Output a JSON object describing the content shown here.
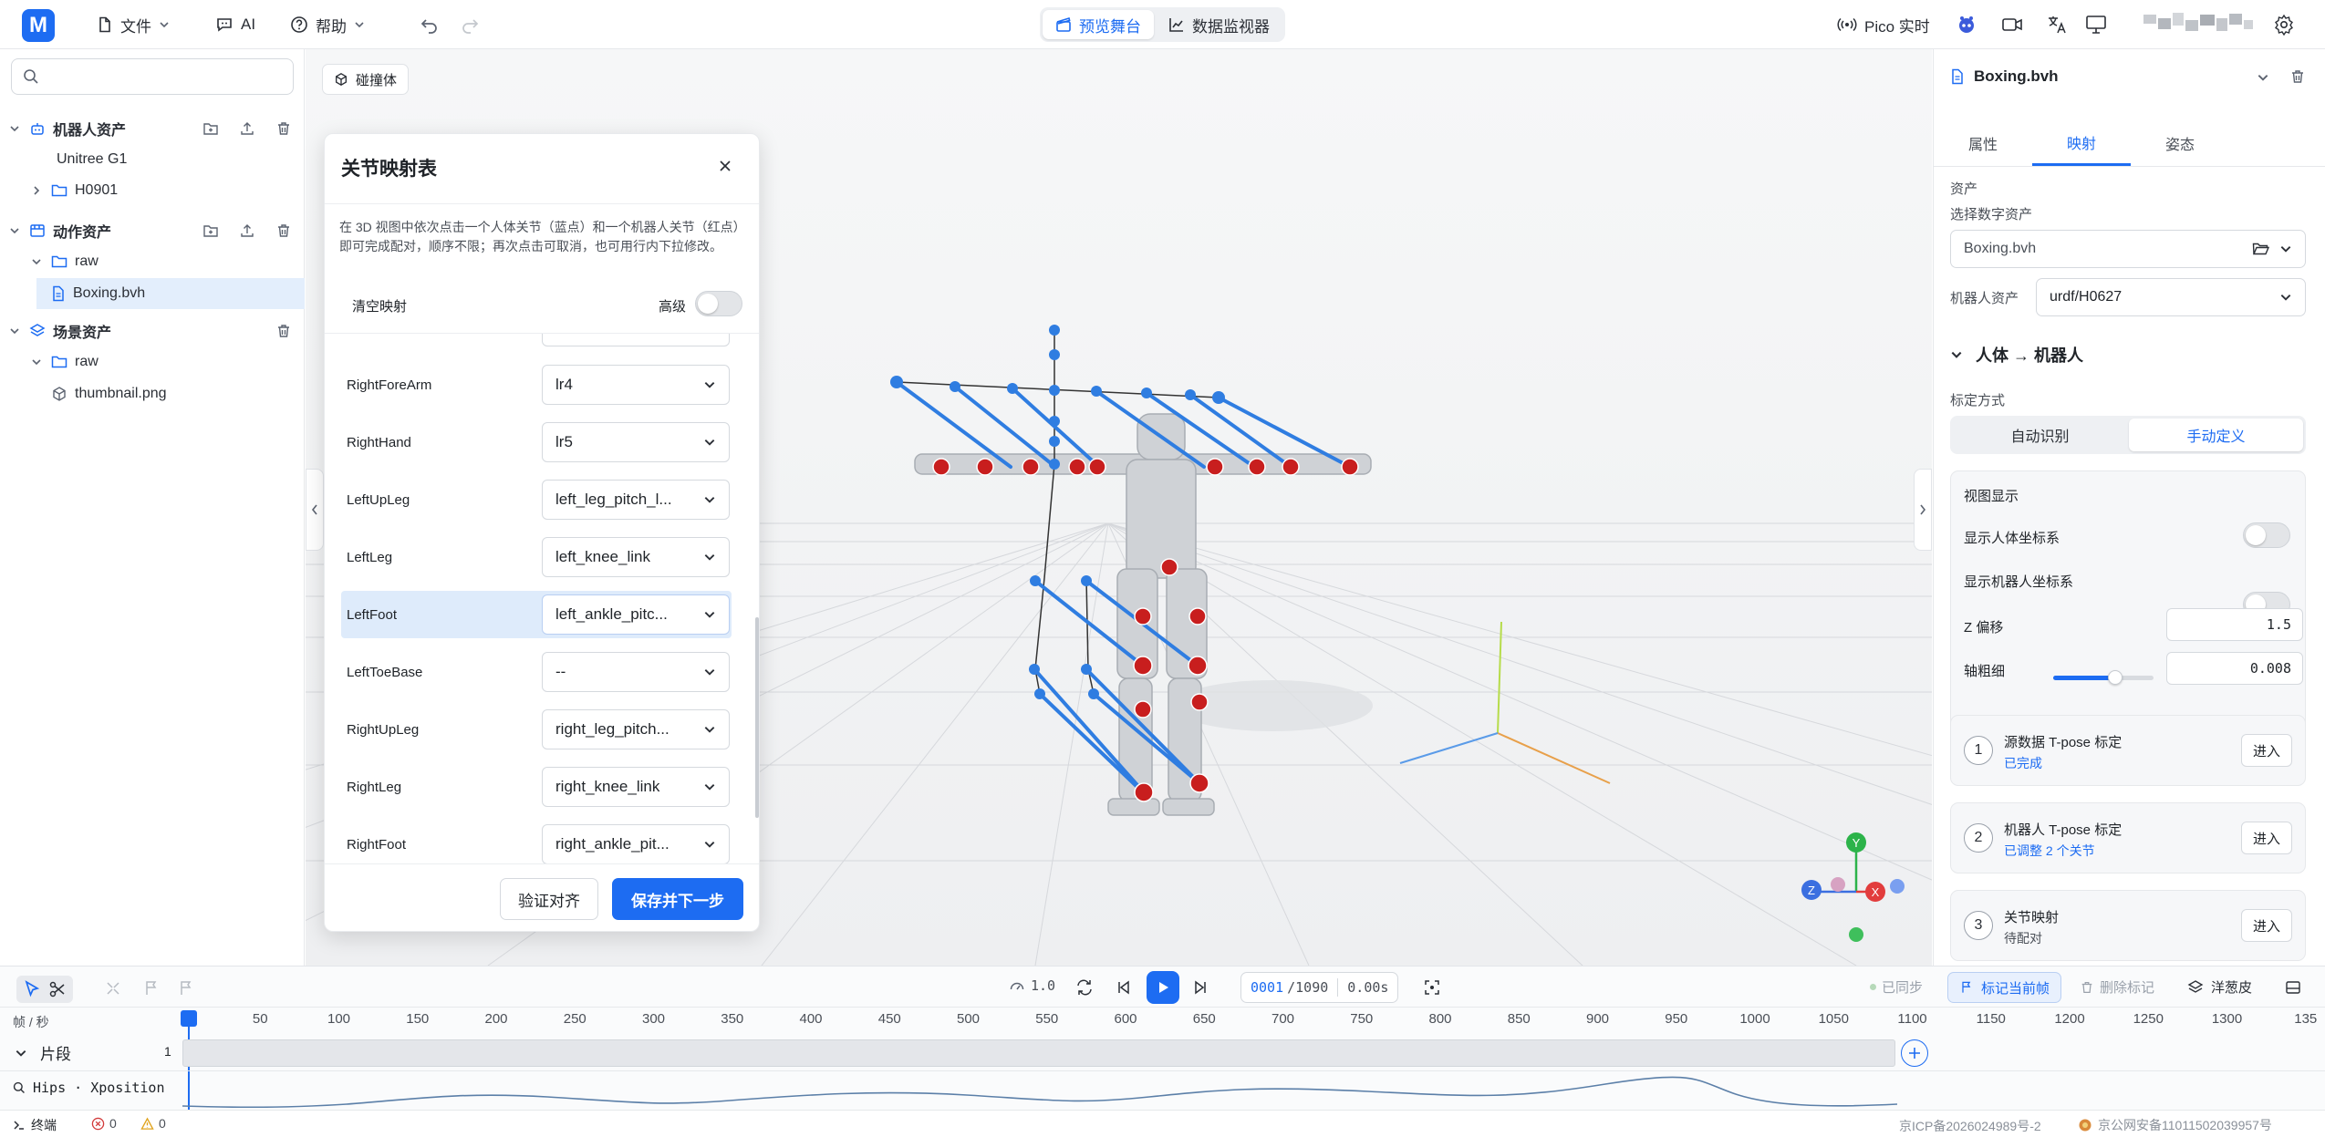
{
  "topbar": {
    "logo": "M",
    "menu": [
      {
        "label": "文件",
        "icon": "file-icon"
      },
      {
        "label": "AI",
        "icon": "ai-chat-icon"
      },
      {
        "label": "帮助",
        "icon": "help-icon"
      }
    ],
    "views": [
      {
        "label": "预览舞台",
        "icon": "clapperboard-icon",
        "active": true
      },
      {
        "label": "数据监视器",
        "icon": "line-chart-icon",
        "active": false
      }
    ],
    "pico_label": "Pico 实时"
  },
  "sidebar": {
    "search_placeholder": "",
    "tree": [
      {
        "label": "机器人资产",
        "level": 0,
        "type": "group",
        "expanded": true,
        "actions": true
      },
      {
        "label": "Unitree G1",
        "level": 1,
        "type": "item"
      },
      {
        "label": "H0901",
        "level": 1,
        "type": "folder",
        "expanded": false
      },
      {
        "label": "动作资产",
        "level": 0,
        "type": "group",
        "expanded": true,
        "actions": true
      },
      {
        "label": "raw",
        "level": 1,
        "type": "folder",
        "expanded": true
      },
      {
        "label": "Boxing.bvh",
        "level": 2,
        "type": "file",
        "selected": true
      },
      {
        "label": "场景资产",
        "level": 0,
        "type": "group",
        "expanded": true,
        "actions": "delete-only"
      },
      {
        "label": "raw",
        "level": 1,
        "type": "folder",
        "expanded": true
      },
      {
        "label": "thumbnail.png",
        "level": 2,
        "type": "image"
      }
    ]
  },
  "viewport": {
    "collider_chip": "碰撞体"
  },
  "dialog": {
    "title": "关节映射表",
    "description": "在 3D 视图中依次点击一个人体关节（蓝点）和一个机器人关节（红点）即可完成配对，顺序不限；再次点击可取消，也可用行内下拉修改。",
    "clear_label": "清空映射",
    "advanced_label": "高级",
    "rows": [
      {
        "joint": "RightForeArm",
        "value": "lr4"
      },
      {
        "joint": "RightHand",
        "value": "lr5"
      },
      {
        "joint": "LeftUpLeg",
        "value": "left_leg_pitch_l..."
      },
      {
        "joint": "LeftLeg",
        "value": "left_knee_link"
      },
      {
        "joint": "LeftFoot",
        "value": "left_ankle_pitc...",
        "highlight": true
      },
      {
        "joint": "LeftToeBase",
        "value": "--"
      },
      {
        "joint": "RightUpLeg",
        "value": "right_leg_pitch..."
      },
      {
        "joint": "RightLeg",
        "value": "right_knee_link"
      },
      {
        "joint": "RightFoot",
        "value": "right_ankle_pit..."
      }
    ],
    "verify_button": "验证对齐",
    "save_button": "保存并下一步"
  },
  "rpanel": {
    "file_title": "Boxing.bvh",
    "tabs": [
      "属性",
      "映射",
      "姿态"
    ],
    "active_tab": 1,
    "asset_heading": "资产",
    "digital_asset_label": "选择数字资产",
    "digital_asset_value": "Boxing.bvh",
    "robot_asset_label": "机器人资产",
    "robot_asset_value": "urdf/H0627",
    "section_title": "人体 → 机器人",
    "calib_label": "标定方式",
    "calib_options": [
      "自动识别",
      "手动定义"
    ],
    "calib_active": 1,
    "view_card": {
      "title": "视图显示",
      "show_human": "显示人体坐标系",
      "show_robot": "显示机器人坐标系",
      "z_offset_label": "Z 偏移",
      "z_offset_value": "1.5",
      "z_offset_fraction": 0.62,
      "thickness_label": "轴粗细",
      "thickness_value": "0.008",
      "thickness_fraction": 0.25
    },
    "steps": [
      {
        "num": "1",
        "title": "源数据 T-pose 标定",
        "status": "已完成",
        "status_color": "#1d6cf2",
        "button": "进入"
      },
      {
        "num": "2",
        "title": "机器人 T-pose 标定",
        "status": "已调整 2 个关节",
        "status_color": "#1d6cf2",
        "button": "进入"
      },
      {
        "num": "3",
        "title": "关节映射",
        "status": "待配对",
        "status_color": "#4a4f57",
        "button": "进入"
      }
    ]
  },
  "timeline": {
    "speed": "1.0",
    "frame_current": "0001",
    "frame_total": "/1090",
    "time": "0.00s",
    "synced": "已同步",
    "mark_current": "标记当前帧",
    "delete_mark": "删除标记",
    "onion_skin": "洋葱皮",
    "fps_label": "帧 / 秒",
    "ruler": [
      "50",
      "100",
      "150",
      "200",
      "250",
      "300",
      "350",
      "400",
      "450",
      "500",
      "550",
      "600",
      "650",
      "700",
      "750",
      "800",
      "850",
      "900",
      "950",
      "1000",
      "1050",
      "1100",
      "1150",
      "1200",
      "1250",
      "1300",
      "135"
    ],
    "track_segment": "片段",
    "track_segment_num": "1",
    "curve_label": "Hips · Xposition"
  },
  "statusbar": {
    "terminal": "终端",
    "errors": "0",
    "warnings": "0",
    "icp": "京ICP备2026024989号-2",
    "police": "京公网安备11011502039957号"
  },
  "colors": {
    "accent": "#1d6cf2",
    "human_joint": "#2f7de1",
    "robot_joint": "#c81e1e"
  }
}
